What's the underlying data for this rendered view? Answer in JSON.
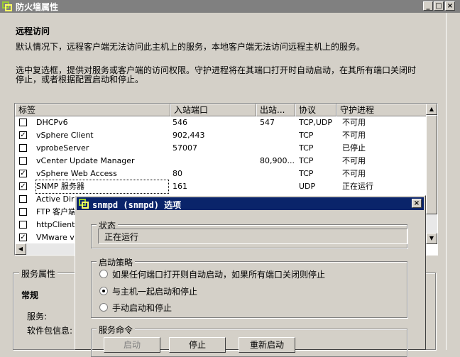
{
  "window": {
    "title": "防火墙属性"
  },
  "remote": {
    "title": "远程访问",
    "desc1": "默认情况下，远程客户端无法访问此主机上的服务，本地客户端无法访问远程主机上的服务。",
    "desc2a": "选中复选框，提供对服务或客户端的访问权限。守护进程将在其端口打开时自动启动，在其所有端口关闭时",
    "desc2b": "停止，或者根据配置启动和停止。"
  },
  "table": {
    "headers": [
      "标签",
      "入站端口",
      "出站...",
      "协议",
      "守护进程"
    ],
    "rows": [
      {
        "checked": false,
        "label": "DHCPv6",
        "in": "546",
        "out": "547",
        "proto": "TCP,UDP",
        "daemon": "不可用"
      },
      {
        "checked": true,
        "label": "vSphere Client",
        "in": "902,443",
        "out": "",
        "proto": "TCP",
        "daemon": "不可用"
      },
      {
        "checked": false,
        "label": "vprobeServer",
        "in": "57007",
        "out": "",
        "proto": "TCP",
        "daemon": "已停止"
      },
      {
        "checked": false,
        "label": "vCenter Update Manager",
        "in": "",
        "out": "80,900...",
        "proto": "TCP",
        "daemon": "不可用"
      },
      {
        "checked": true,
        "label": "vSphere Web Access",
        "in": "80",
        "out": "",
        "proto": "TCP",
        "daemon": "不可用"
      },
      {
        "checked": true,
        "label": "SNMP 服务器",
        "in": "161",
        "out": "",
        "proto": "UDP",
        "daemon": "正在运行"
      },
      {
        "checked": false,
        "label": "Active Direc",
        "in": "",
        "out": "",
        "proto": "",
        "daemon": ""
      },
      {
        "checked": false,
        "label": "FTP 客户端",
        "in": "",
        "out": "",
        "proto": "",
        "daemon": ""
      },
      {
        "checked": false,
        "label": "httpClient",
        "in": "",
        "out": "",
        "proto": "",
        "daemon": ""
      },
      {
        "checked": true,
        "label": "VMware vC",
        "in": "",
        "out": "",
        "proto": "",
        "daemon": ""
      }
    ]
  },
  "service_props": {
    "title": "服务属性",
    "general": "常规",
    "service_label": "服务:",
    "package_label": "软件包信息:"
  },
  "dialog": {
    "title": "snmpd (snmpd) 选项",
    "status_group": "状态",
    "status_value": "正在运行",
    "policy_group": "启动策略",
    "options": [
      {
        "label": "如果任何端口打开则自动启动，如果所有端口关闭则停止",
        "selected": false
      },
      {
        "label": "与主机一起启动和停止",
        "selected": true
      },
      {
        "label": "手动启动和停止",
        "selected": false
      }
    ],
    "commands_group": "服务命令",
    "btn_start": "启动",
    "btn_stop": "停止",
    "btn_restart": "重新启动"
  },
  "icons": {
    "close": "×",
    "minimize": "_",
    "maximize": "□",
    "up": "▲",
    "down": "▼",
    "left": "◀"
  }
}
